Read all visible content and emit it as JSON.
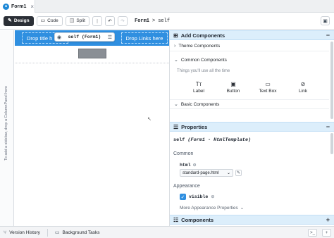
{
  "tab": {
    "title": "Form1",
    "close": "×",
    "logo": "a"
  },
  "toolbar": {
    "design": "Design",
    "code": "Code",
    "split": "Split",
    "more": "⋮",
    "undo": "↶",
    "redo": "↷",
    "crumb1": "Form1",
    "crumb_sep": ">",
    "crumb2": "self",
    "panel_toggle": "▣"
  },
  "canvas": {
    "drop_title": "Drop title h",
    "drop_links": "Drop Links here",
    "selection_popup": "self (Form1)",
    "placeholder_button": "",
    "sidebar_hint": "To add a sidebar, drop a ColumnPanel here"
  },
  "add_components": {
    "header": "Add Components",
    "collapse": "−",
    "theme_components": "Theme Components",
    "common_components": "Common Components",
    "hint": "Things you'll use all the time",
    "items": [
      {
        "icon": "Tт",
        "label": "Label"
      },
      {
        "icon": "▣",
        "label": "Button"
      },
      {
        "icon": "▭",
        "label": "Text Box"
      },
      {
        "icon": "⊘",
        "label": "Link"
      }
    ],
    "basic_components": "Basic Components"
  },
  "properties": {
    "header": "Properties",
    "collapse": "−",
    "title_prefix": "self",
    "title_italic": "(Form1 - HtmlTemplate)",
    "group_common": "Common",
    "html_label": "html",
    "html_value": "standard-page.html",
    "group_appearance": "Appearance",
    "visible_label": "visible",
    "more_appearance": "More Appearance Properties"
  },
  "components_panel": {
    "header": "Components",
    "expand": "+"
  },
  "bottom": {
    "version_history": "Version History",
    "background_tasks": "Background Tasks"
  },
  "colors": {
    "accent": "#2f8fe0",
    "panel_header": "#dceefb"
  }
}
